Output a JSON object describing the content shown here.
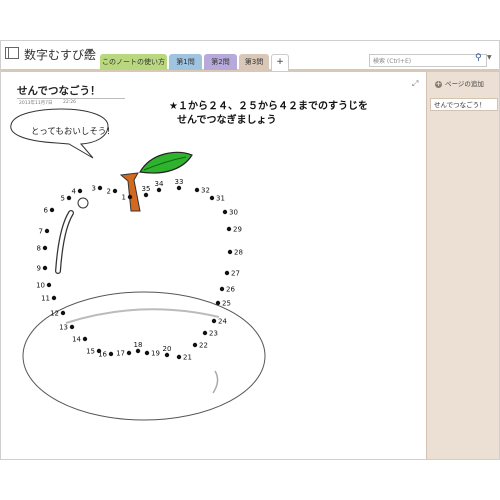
{
  "notebook": {
    "title": "数字むすび絵"
  },
  "tabs": [
    {
      "label": "このノートの使い方"
    },
    {
      "label": "第1問"
    },
    {
      "label": "第2問"
    },
    {
      "label": "第3問"
    },
    {
      "label": "+"
    }
  ],
  "search": {
    "placeholder": "検索 (Ctrl+E)"
  },
  "right_pane": {
    "add_page": "ページの追加",
    "pages": [
      "せんでつなごう！"
    ]
  },
  "page": {
    "title": "せんでつなごう！",
    "date": "2013年11月7日",
    "time": "22:26",
    "instruction_line1": "★１から２４、２５から４２までのすうじを",
    "instruction_line2": "せんでつなぎましょう",
    "bubble": "とってもおいしそう！"
  },
  "dots": [
    {
      "n": "1"
    },
    {
      "n": "2"
    },
    {
      "n": "3"
    },
    {
      "n": "4"
    },
    {
      "n": "5"
    },
    {
      "n": "6"
    },
    {
      "n": "7"
    },
    {
      "n": "8"
    },
    {
      "n": "9"
    },
    {
      "n": "10"
    },
    {
      "n": "11"
    },
    {
      "n": "12"
    },
    {
      "n": "13"
    },
    {
      "n": "14"
    },
    {
      "n": "15"
    },
    {
      "n": "16"
    },
    {
      "n": "17"
    },
    {
      "n": "18"
    },
    {
      "n": "19"
    },
    {
      "n": "20"
    },
    {
      "n": "21"
    },
    {
      "n": "22"
    },
    {
      "n": "23"
    },
    {
      "n": "24"
    },
    {
      "n": "25"
    },
    {
      "n": "26"
    },
    {
      "n": "27"
    },
    {
      "n": "28"
    },
    {
      "n": "29"
    },
    {
      "n": "30"
    },
    {
      "n": "31"
    },
    {
      "n": "32"
    },
    {
      "n": "33"
    },
    {
      "n": "34"
    },
    {
      "n": "35"
    }
  ],
  "colors": {
    "tab_green": "#b9d77e",
    "tab_blue": "#9fc4e0",
    "tab_purple": "#b7aadb",
    "tab_active": "#d9c8b7",
    "stem": "#d2691e",
    "leaf": "#2fb32f",
    "pane": "#ecdfd3"
  },
  "icons": [
    "notebook-icon",
    "search-icon",
    "add-page-icon",
    "expand-icon"
  ]
}
